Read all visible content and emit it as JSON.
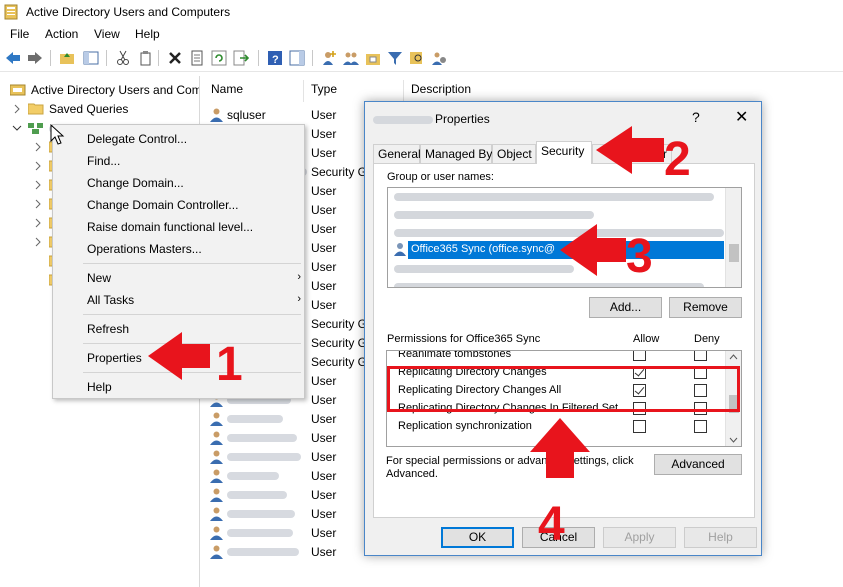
{
  "window": {
    "title": "Active Directory Users and Computers"
  },
  "menu": [
    "File",
    "Action",
    "View",
    "Help"
  ],
  "tree": {
    "root": "Active Directory Users and Com",
    "saved_queries": "Saved Queries"
  },
  "list": {
    "columns": [
      "Name",
      "Type",
      "Description"
    ],
    "rows": [
      {
        "name": "sqluser",
        "type": "User"
      },
      {
        "name": "",
        "type": "User"
      },
      {
        "name": "",
        "type": "User"
      },
      {
        "name": "",
        "type": "Security G"
      },
      {
        "name": "",
        "type": "User"
      },
      {
        "name": "",
        "type": "User"
      },
      {
        "name": "",
        "type": "User"
      },
      {
        "name": "",
        "type": "User"
      },
      {
        "name": "",
        "type": "User"
      },
      {
        "name": "",
        "type": "User"
      },
      {
        "name": "",
        "type": "User"
      },
      {
        "name": "",
        "type": "Security G"
      },
      {
        "name": "",
        "type": "Security G"
      },
      {
        "name": "Template Us...",
        "type": "Security G"
      },
      {
        "name": "",
        "type": "User"
      },
      {
        "name": "",
        "type": "User"
      },
      {
        "name": "",
        "type": "User"
      },
      {
        "name": "",
        "type": "User"
      },
      {
        "name": "",
        "type": "User"
      },
      {
        "name": "",
        "type": "User"
      },
      {
        "name": "",
        "type": "User"
      },
      {
        "name": "",
        "type": "User"
      },
      {
        "name": "",
        "type": "User"
      },
      {
        "name": "",
        "type": "User"
      }
    ]
  },
  "context_menu": {
    "items": [
      "Delegate Control...",
      "Find...",
      "Change Domain...",
      "Change Domain Controller...",
      "Raise domain functional level...",
      "Operations Masters...",
      "New",
      "All Tasks",
      "Refresh",
      "Properties",
      "Help"
    ]
  },
  "dialog": {
    "title": "Properties",
    "help_glyph": "?",
    "close_glyph": "✕",
    "tabs": [
      "General",
      "Managed By",
      "Object",
      "Security",
      "or"
    ],
    "group_label": "Group or user names:",
    "selected_principal": "Office365 Sync (office.sync@",
    "add_button": "Add...",
    "remove_button": "Remove",
    "permissions_label": "Permissions for Office365 Sync",
    "allow_label": "Allow",
    "deny_label": "Deny",
    "permissions": [
      {
        "name": "Reanimate tombstones",
        "allow": false,
        "deny": false
      },
      {
        "name": "Replicating Directory Changes",
        "allow": true,
        "deny": false
      },
      {
        "name": "Replicating Directory Changes All",
        "allow": true,
        "deny": false
      },
      {
        "name": "Replicating Directory Changes In Filtered Set",
        "allow": false,
        "deny": false
      },
      {
        "name": "Replication synchronization",
        "allow": false,
        "deny": false
      }
    ],
    "special_note": "For special permissions or advanced settings, click Advanced.",
    "advanced_button": "Advanced",
    "ok_button": "OK",
    "cancel_button": "Cancel",
    "apply_button": "Apply",
    "help_button": "Help"
  },
  "annotations": {
    "step1": "1",
    "step2": "2",
    "step3": "3",
    "step4": "4",
    "arrow_color": "#e8141c"
  }
}
